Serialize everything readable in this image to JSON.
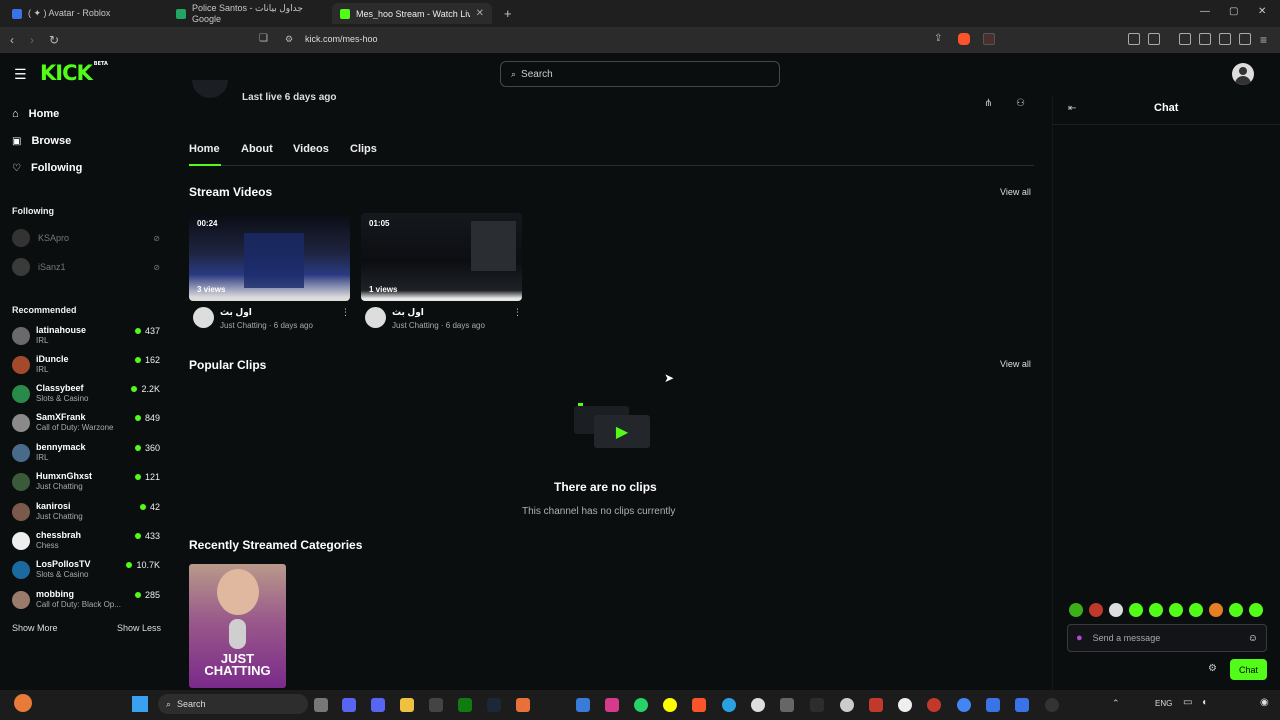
{
  "browser": {
    "tabs": [
      {
        "label": "( ✦ ) Avatar - Roblox"
      },
      {
        "label": "Police Santos - جداول بيانات Google"
      },
      {
        "label": "Mes_hoo Stream - Watch Live on"
      }
    ],
    "url": "kick.com/mes-hoo",
    "win_min": "—",
    "win_max": "▢",
    "win_close": "✕"
  },
  "header": {
    "logo": "KICK",
    "logo_badge": "BETA",
    "search_placeholder": "Search"
  },
  "sidebar": {
    "nav": [
      {
        "label": "Home"
      },
      {
        "label": "Browse"
      },
      {
        "label": "Following"
      }
    ],
    "following_title": "Following",
    "following": [
      {
        "name": "KSApro"
      },
      {
        "name": "iSanz1"
      }
    ],
    "recommended_title": "Recommended",
    "recommended": [
      {
        "name": "latinahouse",
        "category": "IRL",
        "viewers": "437"
      },
      {
        "name": "iDuncle",
        "category": "IRL",
        "viewers": "162"
      },
      {
        "name": "Classybeef",
        "category": "Slots & Casino",
        "viewers": "2.2K"
      },
      {
        "name": "SamXFrank",
        "category": "Call of Duty: Warzone",
        "viewers": "849"
      },
      {
        "name": "bennymack",
        "category": "IRL",
        "viewers": "360"
      },
      {
        "name": "HumxnGhxst",
        "category": "Just Chatting",
        "viewers": "121"
      },
      {
        "name": "kanirosi",
        "category": "Just Chatting",
        "viewers": "42"
      },
      {
        "name": "chessbrah",
        "category": "Chess",
        "viewers": "433"
      },
      {
        "name": "LosPollosTV",
        "category": "Slots & Casino",
        "viewers": "10.7K"
      },
      {
        "name": "mobbing",
        "category": "Call of Duty: Black Op...",
        "viewers": "285"
      }
    ],
    "show_more": "Show More",
    "show_less": "Show Less"
  },
  "channel": {
    "last_live": "Last live 6 days ago"
  },
  "tabs": [
    {
      "label": "Home"
    },
    {
      "label": "About"
    },
    {
      "label": "Videos"
    },
    {
      "label": "Clips"
    }
  ],
  "stream_videos": {
    "title": "Stream Videos",
    "view_all": "View all",
    "items": [
      {
        "duration": "00:24",
        "views": "3 views",
        "title": "اول بث",
        "meta": "Just Chatting · 6 days ago"
      },
      {
        "duration": "01:05",
        "views": "1 views",
        "title": "اول بث",
        "meta": "Just Chatting · 6 days ago"
      }
    ]
  },
  "popular_clips": {
    "title": "Popular Clips",
    "view_all": "View all",
    "empty_title": "There are no clips",
    "empty_sub": "This channel has no clips currently"
  },
  "recent_categories": {
    "title": "Recently Streamed Categories",
    "items": [
      {
        "line1": "JUST",
        "line2": "CHATTING"
      }
    ]
  },
  "chat": {
    "title": "Chat",
    "input_placeholder": "Send a message",
    "send_label": "Chat"
  },
  "taskbar": {
    "search": "Search",
    "lang": "ENG"
  }
}
